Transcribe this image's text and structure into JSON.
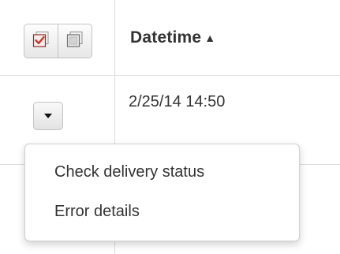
{
  "table": {
    "header": {
      "datetime_label": "Datetime",
      "sort_indicator": "▲"
    },
    "rows": [
      {
        "datetime": "2/25/14 14:50"
      }
    ]
  },
  "toolbar": {
    "icons": [
      "checked-checkbox-icon",
      "checkbox-stack-icon"
    ]
  },
  "row_actions_menu": {
    "items": [
      {
        "label": "Check delivery status"
      },
      {
        "label": "Error details"
      }
    ]
  },
  "colors": {
    "grid_line": "#dddddd",
    "text": "#333333",
    "check_accent": "#c0392b"
  }
}
